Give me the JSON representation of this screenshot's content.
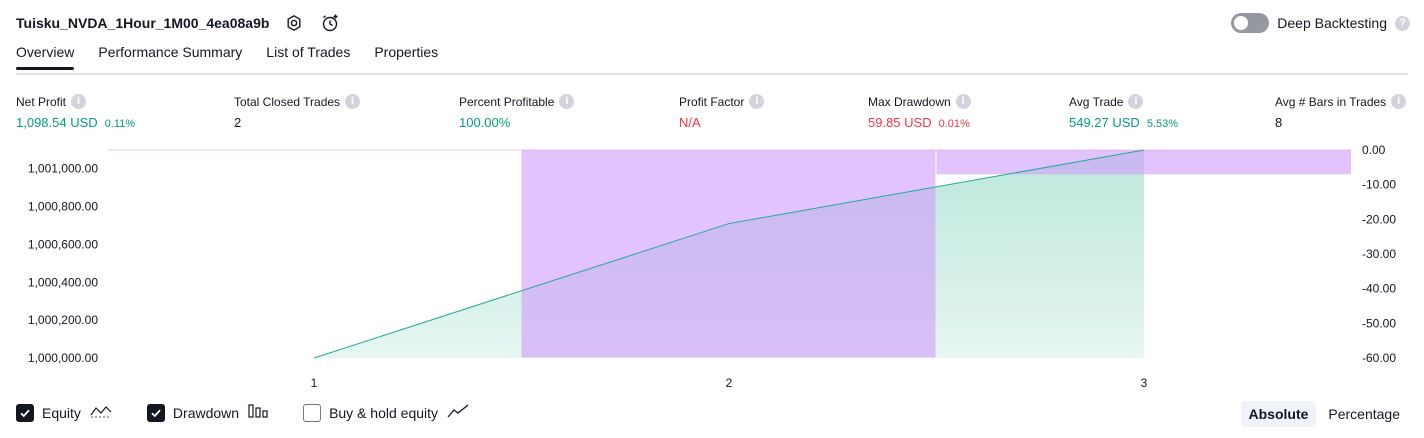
{
  "header": {
    "strategy_name": "Tuisku_NVDA_1Hour_1M00_4ea08a9b",
    "deep_backtesting_label": "Deep Backtesting",
    "deep_backtesting_enabled": false
  },
  "tabs": [
    {
      "label": "Overview",
      "active": true
    },
    {
      "label": "Performance Summary",
      "active": false
    },
    {
      "label": "List of Trades",
      "active": false
    },
    {
      "label": "Properties",
      "active": false
    }
  ],
  "metrics": [
    {
      "label": "Net Profit",
      "value": "1,098.54 USD",
      "pct": "0.11%",
      "color": "green"
    },
    {
      "label": "Total Closed Trades",
      "value": "2",
      "pct": "",
      "color": "dark"
    },
    {
      "label": "Percent Profitable",
      "value": "100.00%",
      "pct": "",
      "color": "green"
    },
    {
      "label": "Profit Factor",
      "value": "N/A",
      "pct": "",
      "color": "red"
    },
    {
      "label": "Max Drawdown",
      "value": "59.85 USD",
      "pct": "0.01%",
      "color": "red"
    },
    {
      "label": "Avg Trade",
      "value": "549.27 USD",
      "pct": "5.53%",
      "color": "green"
    },
    {
      "label": "Avg # Bars in Trades",
      "value": "8",
      "pct": "",
      "color": "dark"
    }
  ],
  "chart_data": {
    "type": "line",
    "x": [
      1,
      2,
      3
    ],
    "equity": [
      1000000.0,
      1000710.0,
      1001098.54
    ],
    "drawdown": [
      {
        "from": 1.5,
        "to": 2.5,
        "value": -59.85
      },
      {
        "from": 2.5,
        "to": 3.5,
        "value": -7.0
      }
    ],
    "left_axis_ticks": [
      "1,001,000.00",
      "1,000,800.00",
      "1,000,600.00",
      "1,000,400.00",
      "1,000,200.00",
      "1,000,000.00"
    ],
    "left_axis_values": [
      1001000,
      1000800,
      1000600,
      1000400,
      1000200,
      1000000
    ],
    "left_ylim": [
      1000000,
      1001098.54
    ],
    "right_axis_ticks": [
      "0.00",
      "-10.00",
      "-20.00",
      "-30.00",
      "-40.00",
      "-50.00",
      "-60.00"
    ],
    "right_axis_values": [
      0,
      -10,
      -20,
      -30,
      -40,
      -50,
      -60
    ],
    "right_ylim": [
      -60,
      0
    ],
    "x_ticks": [
      "1",
      "2",
      "3"
    ],
    "colors": {
      "equity_line": "#22ab94",
      "equity_fill": "#b8e6d9",
      "drawdown_fill": "#ce9bfc"
    }
  },
  "footer": {
    "toggles": [
      {
        "label": "Equity",
        "checked": true,
        "icon": "equity-line-icon"
      },
      {
        "label": "Drawdown",
        "checked": true,
        "icon": "drawdown-bars-icon"
      },
      {
        "label": "Buy & hold equity",
        "checked": false,
        "icon": "buy-hold-line-icon"
      }
    ],
    "modes": [
      {
        "label": "Absolute",
        "selected": true
      },
      {
        "label": "Percentage",
        "selected": false
      }
    ]
  }
}
